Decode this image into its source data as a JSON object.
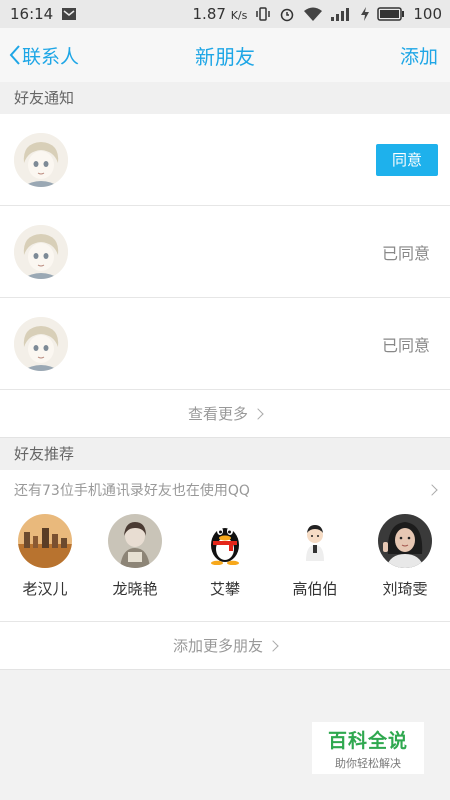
{
  "status": {
    "time": "16:14",
    "speed": "1.87",
    "speed_unit": "K/s",
    "battery": "100"
  },
  "nav": {
    "back_label": "联系人",
    "title": "新朋友",
    "add_label": "添加"
  },
  "notifications": {
    "header": "好友通知",
    "items": [
      {
        "action": "同意",
        "state": "pending"
      },
      {
        "action": "已同意",
        "state": "accepted"
      },
      {
        "action": "已同意",
        "state": "accepted"
      }
    ],
    "more_label": "查看更多"
  },
  "recommendations": {
    "header": "好友推荐",
    "hint": "还有73位手机通讯录好友也在使用QQ",
    "people": [
      {
        "name": "老汉儿",
        "avatar": "city-photo"
      },
      {
        "name": "龙晓艳",
        "avatar": "girl-photo"
      },
      {
        "name": "艾攀",
        "avatar": "qq-penguin"
      },
      {
        "name": "高伯伯",
        "avatar": "cartoon-boy"
      },
      {
        "name": "刘琦雯",
        "avatar": "woman-photo"
      }
    ],
    "add_more_label": "添加更多朋友"
  },
  "watermark": {
    "main": "百科全说",
    "sub": "助你轻松解决"
  },
  "colors": {
    "accent": "#1ea6e6",
    "button": "#1eb1ec",
    "watermark_green": "#2fa84f"
  }
}
